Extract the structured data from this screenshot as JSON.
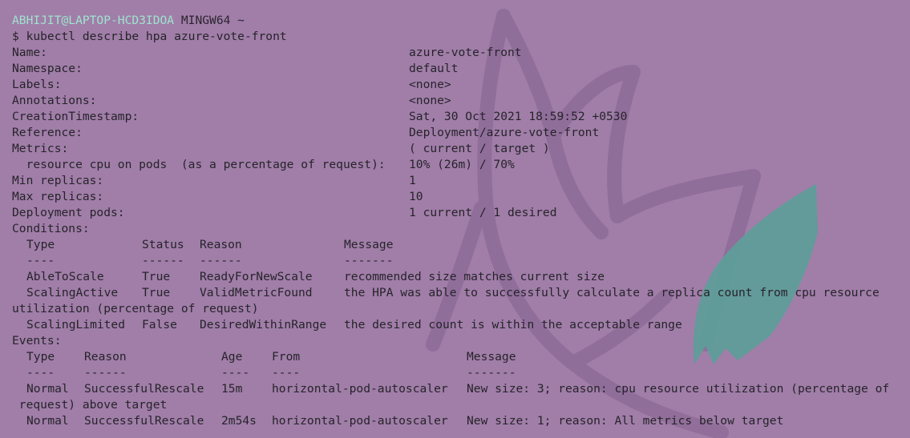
{
  "theme": {
    "background": "#a07ea8",
    "text": "#27232b",
    "prompt_user_color": "#9fe3cf",
    "art_shape_color": "#8e6c98",
    "art_accent_color": "#5f9d99"
  },
  "prompt": {
    "user_host": "ABHIJIT@LAPTOP-HCD3IDOA",
    "system": "MINGW64 ~",
    "command": "$ kubectl describe hpa azure-vote-front"
  },
  "fields": [
    {
      "key": "Name:",
      "value": "azure-vote-front"
    },
    {
      "key": "Namespace:",
      "value": "default"
    },
    {
      "key": "Labels:",
      "value": "<none>"
    },
    {
      "key": "Annotations:",
      "value": "<none>"
    },
    {
      "key": "CreationTimestamp:",
      "value": "Sat, 30 Oct 2021 18:59:52 +0530"
    },
    {
      "key": "Reference:",
      "value": "Deployment/azure-vote-front"
    },
    {
      "key": "Metrics:",
      "value": "( current / target )"
    },
    {
      "key": "  resource cpu on pods  (as a percentage of request):",
      "value": "10% (26m) / 70%"
    },
    {
      "key": "Min replicas:",
      "value": "1"
    },
    {
      "key": "Max replicas:",
      "value": "10"
    },
    {
      "key": "Deployment pods:",
      "value": "1 current / 1 desired"
    }
  ],
  "conditions": {
    "heading": "Conditions:",
    "headers": [
      "Type",
      "Status",
      "Reason",
      "Message"
    ],
    "underline": [
      "----",
      "------",
      "------",
      "-------"
    ],
    "rows": [
      {
        "type": "AbleToScale",
        "status": "True",
        "reason": "ReadyForNewScale",
        "message": "recommended size matches current size",
        "message_cont": ""
      },
      {
        "type": "ScalingActive",
        "status": "True",
        "reason": "ValidMetricFound",
        "message": "the HPA was able to successfully calculate a replica count from cpu resource",
        "message_cont": "utilization (percentage of request)"
      },
      {
        "type": "ScalingLimited",
        "status": "False",
        "reason": "DesiredWithinRange",
        "message": "the desired count is within the acceptable range",
        "message_cont": ""
      }
    ]
  },
  "events": {
    "heading": "Events:",
    "headers": [
      "Type",
      "Reason",
      "Age",
      "From",
      "Message"
    ],
    "underline": [
      "----",
      "------",
      "----",
      "----",
      "-------"
    ],
    "rows": [
      {
        "type": "Normal",
        "reason": "SuccessfulRescale",
        "age": "15m",
        "from": "horizontal-pod-autoscaler",
        "message": "New size: 3; reason: cpu resource utilization (percentage of",
        "message_cont": " request) above target"
      },
      {
        "type": "Normal",
        "reason": "SuccessfulRescale",
        "age": "2m54s",
        "from": "horizontal-pod-autoscaler",
        "message": "New size: 1; reason: All metrics below target",
        "message_cont": ""
      }
    ]
  }
}
